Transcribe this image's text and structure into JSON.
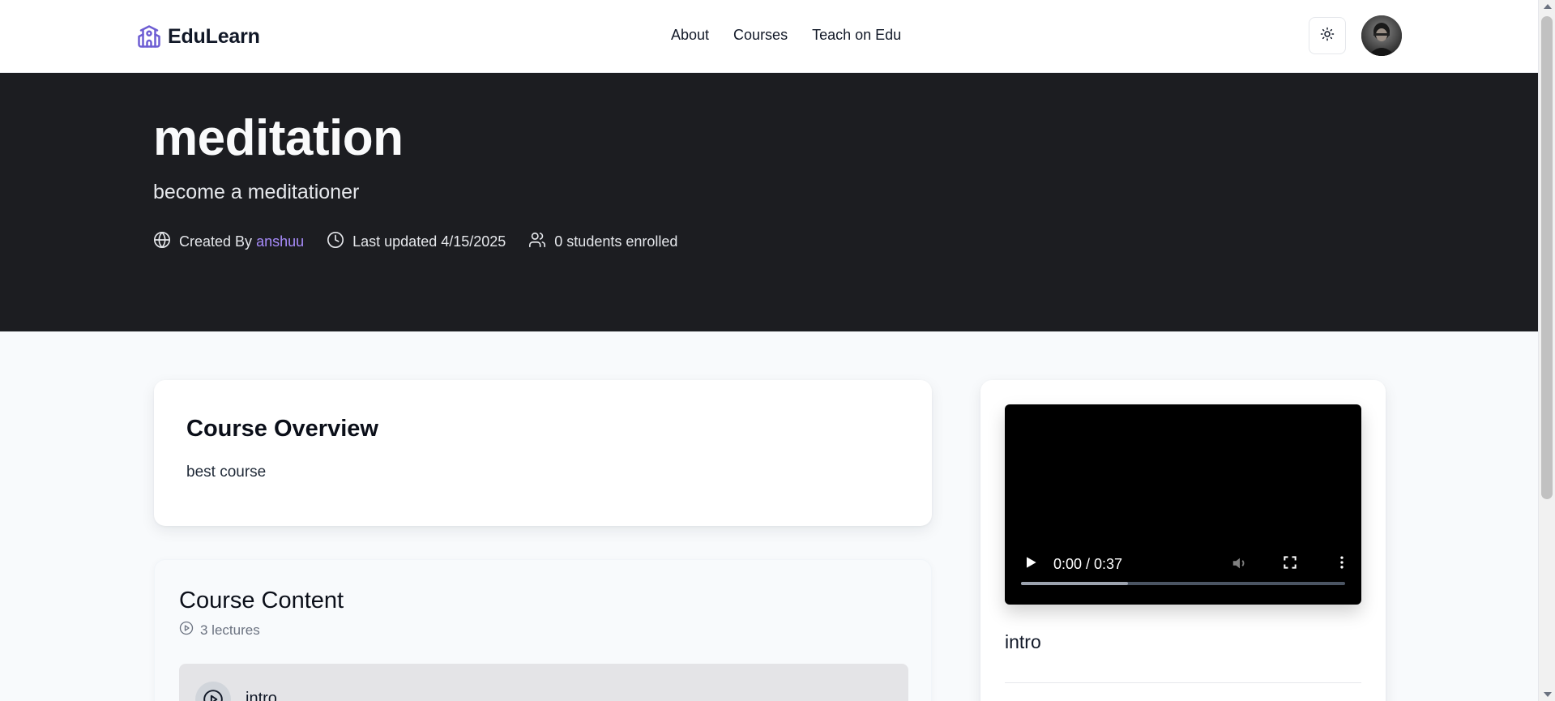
{
  "header": {
    "brand": "EduLearn",
    "nav": [
      "About",
      "Courses",
      "Teach on Edu"
    ]
  },
  "course": {
    "title": "meditation",
    "subtitle": "become a meditationer",
    "created_by_label": "Created By",
    "creator": "anshuu",
    "last_updated": "Last updated 4/15/2025",
    "students": "0 students enrolled"
  },
  "overview": {
    "heading": "Course Overview",
    "description": "best course"
  },
  "content": {
    "heading": "Course Content",
    "lectures_count": "3 lectures",
    "lectures": [
      {
        "title": "intro"
      }
    ]
  },
  "side": {
    "video": {
      "time": "0:00 / 0:37",
      "progress": 0.33
    },
    "lecture_title": "intro"
  },
  "colors": {
    "brand": "#6d5dd3",
    "hero_bg": "#1c1d21",
    "creator_link": "#a78bfa"
  },
  "icons": {
    "brand": "school-icon",
    "theme": "sun-icon",
    "creator": "globe-icon",
    "updated": "clock-icon",
    "students": "users-icon",
    "lectures": "play-circle-icon"
  }
}
